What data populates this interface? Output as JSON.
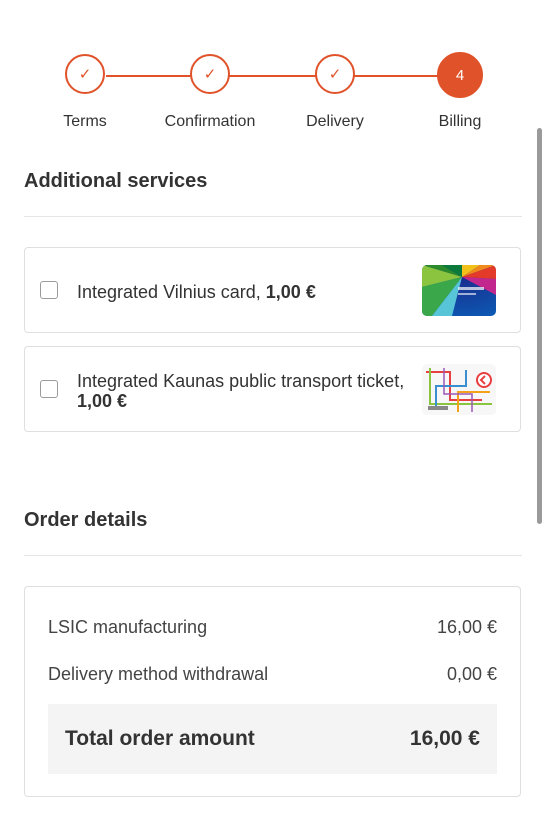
{
  "stepper": {
    "steps": [
      {
        "label": "Terms",
        "state": "done",
        "mark": "✓"
      },
      {
        "label": "Confirmation",
        "state": "done",
        "mark": "✓"
      },
      {
        "label": "Delivery",
        "state": "done",
        "mark": "✓"
      },
      {
        "label": "Billing",
        "state": "current",
        "mark": "4"
      }
    ],
    "accent_color": "#e0532a"
  },
  "additional_services": {
    "title": "Additional services",
    "items": [
      {
        "text": "Integrated Vilnius card, ",
        "price": "1,00 €",
        "checked": false,
        "image": "vilnius-card-image"
      },
      {
        "text": "Integrated Kaunas public transport ticket, ",
        "price": "1,00 €",
        "checked": false,
        "image": "kaunas-ticket-image"
      }
    ]
  },
  "order_details": {
    "title": "Order details",
    "rows": [
      {
        "label": "LSIC manufacturing",
        "value": "16,00 €"
      },
      {
        "label": "Delivery method withdrawal",
        "value": "0,00 €"
      }
    ],
    "total_label": "Total order amount",
    "total_value": "16,00 €"
  }
}
